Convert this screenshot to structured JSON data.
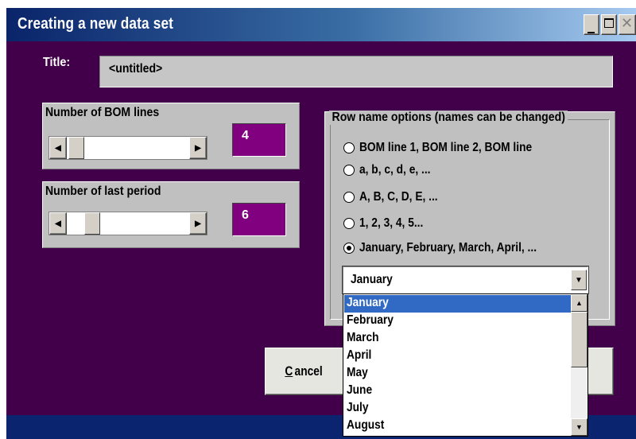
{
  "window": {
    "title": "Creating a new data set",
    "controls": {
      "minimize": "_",
      "maximize": "□",
      "close": "✕"
    }
  },
  "title_field": {
    "label": "Title:",
    "value": "<untitled>"
  },
  "bom_lines": {
    "label": "Number of BOM lines",
    "value": "4",
    "left_arrow": "◀",
    "right_arrow": "▶"
  },
  "last_period": {
    "label": "Number of last period",
    "value": "6",
    "left_arrow": "◀",
    "right_arrow": "▶"
  },
  "row_name_options": {
    "label": "Row name options (names can be changed)",
    "options": [
      {
        "label": "BOM line 1, BOM line 2, BOM line",
        "selected": false
      },
      {
        "label": "a, b, c, d, e, ...",
        "selected": false
      },
      {
        "label": "A, B, C, D, E, ...",
        "selected": false
      },
      {
        "label": "1, 2, 3, 4, 5...",
        "selected": false
      },
      {
        "label": "January, February, March, April, ...",
        "selected": true
      }
    ]
  },
  "month_combo": {
    "value": "January",
    "arrow": "▼",
    "list": [
      "January",
      "February",
      "March",
      "April",
      "May",
      "June",
      "July",
      "August"
    ],
    "highlighted": "January",
    "scroll_up": "▲",
    "scroll_down": "▼"
  },
  "cancel_button": {
    "mnemonic": "C",
    "rest": "ancel"
  }
}
